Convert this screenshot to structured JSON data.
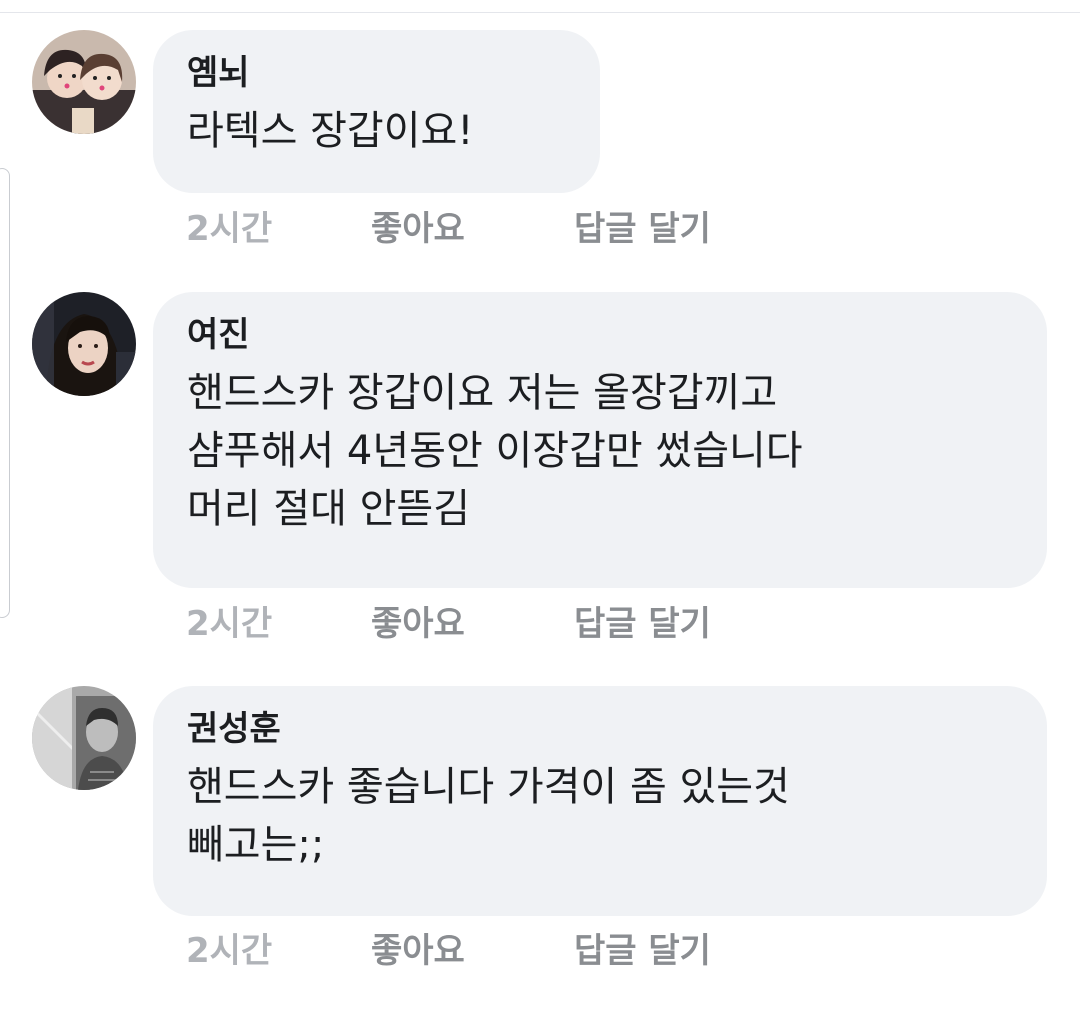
{
  "comments": [
    {
      "author": "옘뇌",
      "lines": [
        "라텍스 장갑이요!"
      ],
      "time": "2시간",
      "like_label": "좋아요",
      "reply_label": "답글 달기",
      "avatar_icon": "profile-photo-avatar"
    },
    {
      "author": "여진",
      "lines": [
        "핸드스카 장갑이요 저는 올장갑끼고",
        "샴푸해서 4년동안 이장갑만 썼습니다",
        "머리 절대 안뜯김"
      ],
      "time": "2시간",
      "like_label": "좋아요",
      "reply_label": "답글 달기",
      "avatar_icon": "profile-photo-avatar"
    },
    {
      "author": "권성훈",
      "lines": [
        "핸드스카 좋습니다 가격이 좀 있는것",
        "빼고는;;"
      ],
      "time": "2시간",
      "like_label": "좋아요",
      "reply_label": "답글 달기",
      "avatar_icon": "profile-photo-avatar"
    }
  ],
  "colors": {
    "bubble_bg": "#f0f2f5",
    "text": "#1c1e21",
    "meta_text": "#8a8d91"
  }
}
